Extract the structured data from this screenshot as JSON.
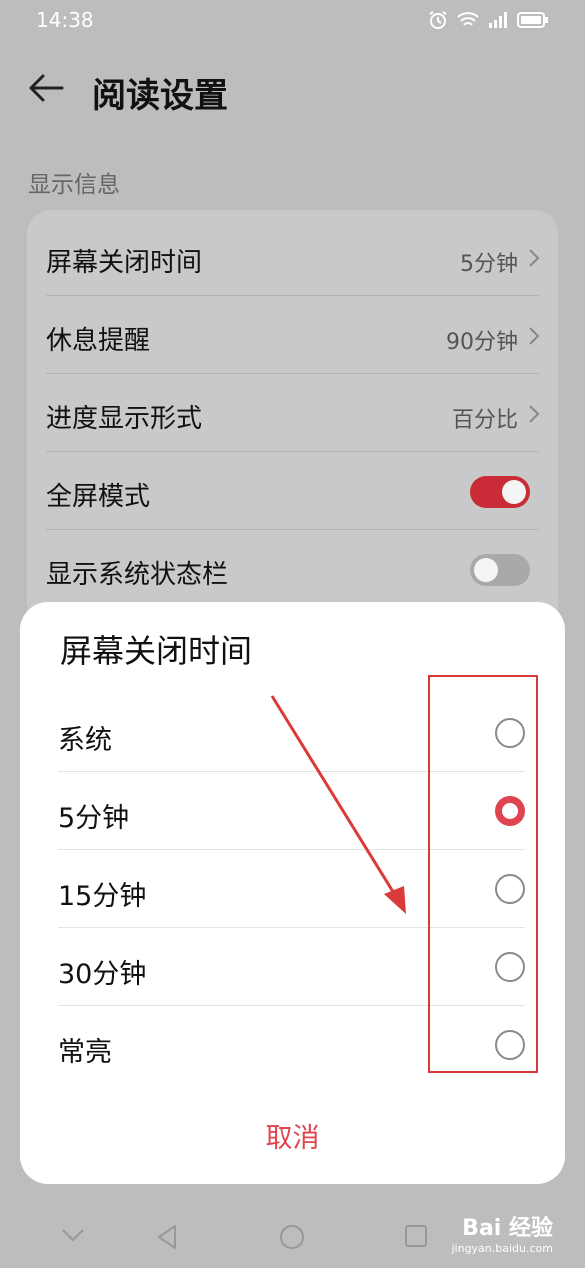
{
  "status_bar": {
    "time": "14:38"
  },
  "header": {
    "title": "阅读设置",
    "back_icon": "back-arrow-icon"
  },
  "section": {
    "label": "显示信息"
  },
  "settings": {
    "items": [
      {
        "label": "屏幕关闭时间",
        "value": "5分钟"
      },
      {
        "label": "休息提醒",
        "value": "90分钟"
      },
      {
        "label": "进度显示形式",
        "value": "百分比"
      },
      {
        "label": "全屏模式",
        "toggle": true
      },
      {
        "label": "显示系统状态栏",
        "toggle": false
      }
    ]
  },
  "dialog": {
    "title": "屏幕关闭时间",
    "options": [
      {
        "label": "系统",
        "selected": false
      },
      {
        "label": "5分钟",
        "selected": true
      },
      {
        "label": "15分钟",
        "selected": false
      },
      {
        "label": "30分钟",
        "selected": false
      },
      {
        "label": "常亮",
        "selected": false
      }
    ],
    "cancel_label": "取消"
  },
  "colors": {
    "accent": "#e0444f",
    "toggle_on": "#c92c36",
    "annotation": "#d93a3a"
  },
  "watermark": {
    "logo": "Bai 经验",
    "url": "jingyan.baidu.com"
  }
}
